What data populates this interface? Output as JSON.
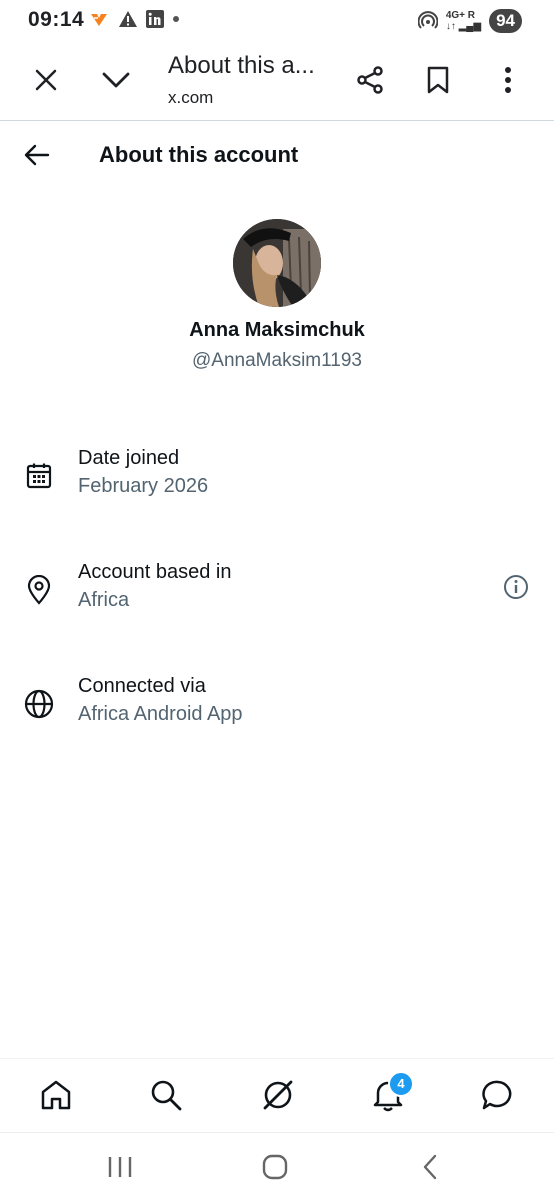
{
  "status_bar": {
    "time": "09:14",
    "icons_left": [
      "heart-app-icon",
      "warning-icon",
      "linkedin-icon",
      "dot-icon"
    ],
    "network": "4G+",
    "roaming": "R",
    "battery": "94"
  },
  "browser_bar": {
    "title": "About this a...",
    "url": "x.com",
    "icons": [
      "close-icon",
      "chevron-down-icon",
      "share-icon",
      "bookmark-icon",
      "more-icon"
    ]
  },
  "header": {
    "title": "About this account"
  },
  "profile": {
    "display_name": "Anna Maksimchuk",
    "handle": "@AnnaMaksim1193"
  },
  "info_rows": [
    {
      "icon": "calendar-icon",
      "label": "Date joined",
      "value": "February 2026"
    },
    {
      "icon": "location-pin-icon",
      "label": "Account based in",
      "value": "Africa",
      "has_info": true
    },
    {
      "icon": "globe-icon",
      "label": "Connected via",
      "value": "Africa Android App"
    }
  ],
  "bottom_nav": {
    "items": [
      "home-icon",
      "search-icon",
      "grok-icon",
      "notifications-icon",
      "messages-icon"
    ],
    "notifications_badge": "4"
  },
  "colors": {
    "primary_text": "#0f1419",
    "secondary_text": "#536471",
    "accent": "#1d9bf0"
  }
}
